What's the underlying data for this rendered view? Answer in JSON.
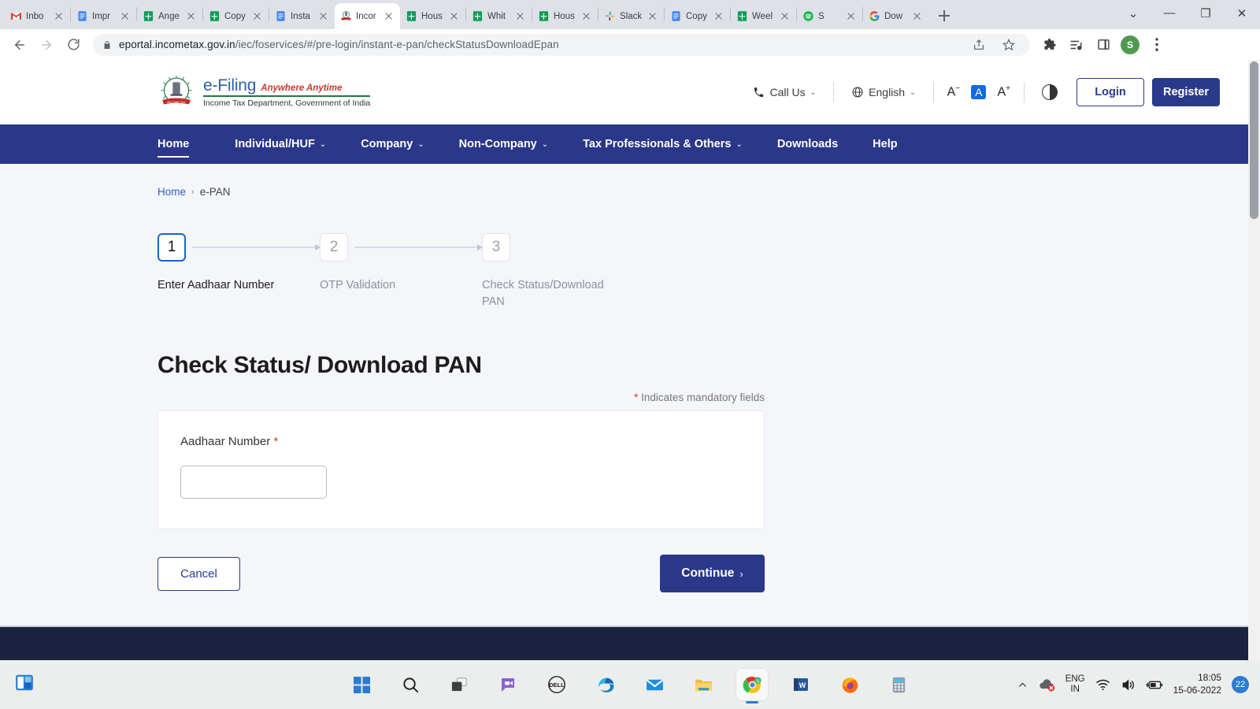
{
  "browser": {
    "tabs": [
      {
        "title": "Inbo",
        "favicon": "gmail-icon",
        "active": false
      },
      {
        "title": "Impr",
        "favicon": "docs-icon",
        "active": false
      },
      {
        "title": "Ange",
        "favicon": "sheets-icon",
        "active": false
      },
      {
        "title": "Copy",
        "favicon": "sheets-icon",
        "active": false
      },
      {
        "title": "Insta",
        "favicon": "docs-icon",
        "active": false
      },
      {
        "title": "Incor",
        "favicon": "incometax-icon",
        "active": true
      },
      {
        "title": "Hous",
        "favicon": "sheets-icon",
        "active": false
      },
      {
        "title": "Whit",
        "favicon": "sheets-icon",
        "active": false
      },
      {
        "title": "Hous",
        "favicon": "sheets-icon",
        "active": false
      },
      {
        "title": "Slack",
        "favicon": "slack-icon",
        "active": false
      },
      {
        "title": "Copy",
        "favicon": "docs-icon",
        "active": false
      },
      {
        "title": "Weel",
        "favicon": "sheets-icon",
        "active": false
      },
      {
        "title": "S",
        "favicon": "spotify-icon",
        "active": false
      },
      {
        "title": "Dow",
        "favicon": "google-icon",
        "active": false
      }
    ],
    "url_secure": "eportal.incometax.gov.in",
    "url_path": "/iec/foservices/#/pre-login/instant-e-pan/checkStatusDownloadEpan",
    "window_controls": [
      "chevron-down",
      "minimize",
      "maximize",
      "close"
    ],
    "profile_initial": "S"
  },
  "site": {
    "logo": {
      "brand": "e-Filing",
      "tagline": "Anywhere Anytime",
      "subtitle": "Income Tax Department, Government of India"
    },
    "header": {
      "call_us": "Call Us",
      "language": "English",
      "font_decrease": "A",
      "font_normal": "A",
      "font_increase": "A",
      "login": "Login",
      "register": "Register"
    },
    "nav": [
      {
        "label": "Home",
        "has_caret": false,
        "active": true
      },
      {
        "label": "Individual/HUF",
        "has_caret": true,
        "active": false
      },
      {
        "label": "Company",
        "has_caret": true,
        "active": false
      },
      {
        "label": "Non-Company",
        "has_caret": true,
        "active": false
      },
      {
        "label": "Tax Professionals & Others",
        "has_caret": true,
        "active": false
      },
      {
        "label": "Downloads",
        "has_caret": false,
        "active": false
      },
      {
        "label": "Help",
        "has_caret": false,
        "active": false
      }
    ],
    "breadcrumb": {
      "home": "Home",
      "separator": "›",
      "current": "e-PAN"
    },
    "stepper": [
      {
        "number": "1",
        "label": "Enter Aadhaar Number",
        "state": "active"
      },
      {
        "number": "2",
        "label": "OTP Validation",
        "state": "inactive"
      },
      {
        "number": "3",
        "label": "Check Status/Download PAN",
        "state": "inactive"
      }
    ],
    "main": {
      "title": "Check Status/ Download PAN",
      "mandatory_note": "Indicates mandatory fields",
      "mandatory_star": "*",
      "field_label": "Aadhaar Number",
      "field_star": "*",
      "field_value": "",
      "cancel": "Cancel",
      "continue": "Continue",
      "continue_chevron": "›"
    }
  },
  "taskbar": {
    "apps": [
      {
        "name": "start-button"
      },
      {
        "name": "search-button"
      },
      {
        "name": "task-view-button"
      },
      {
        "name": "chat-button"
      },
      {
        "name": "dell-button"
      },
      {
        "name": "edge-button"
      },
      {
        "name": "mail-button"
      },
      {
        "name": "file-explorer-button"
      },
      {
        "name": "chrome-button"
      },
      {
        "name": "word-button"
      },
      {
        "name": "firefox-button"
      },
      {
        "name": "calculator-button"
      }
    ],
    "tray": {
      "language_line1": "ENG",
      "language_line2": "IN",
      "time": "18:05",
      "date": "15-06-2022",
      "notification_count": "22"
    }
  },
  "colors": {
    "nav_navy": "#2b3788",
    "footer_navy": "#1c2340",
    "accent_blue": "#1667cf",
    "required_red": "#d0342c",
    "page_bg": "#f4f6fa"
  }
}
